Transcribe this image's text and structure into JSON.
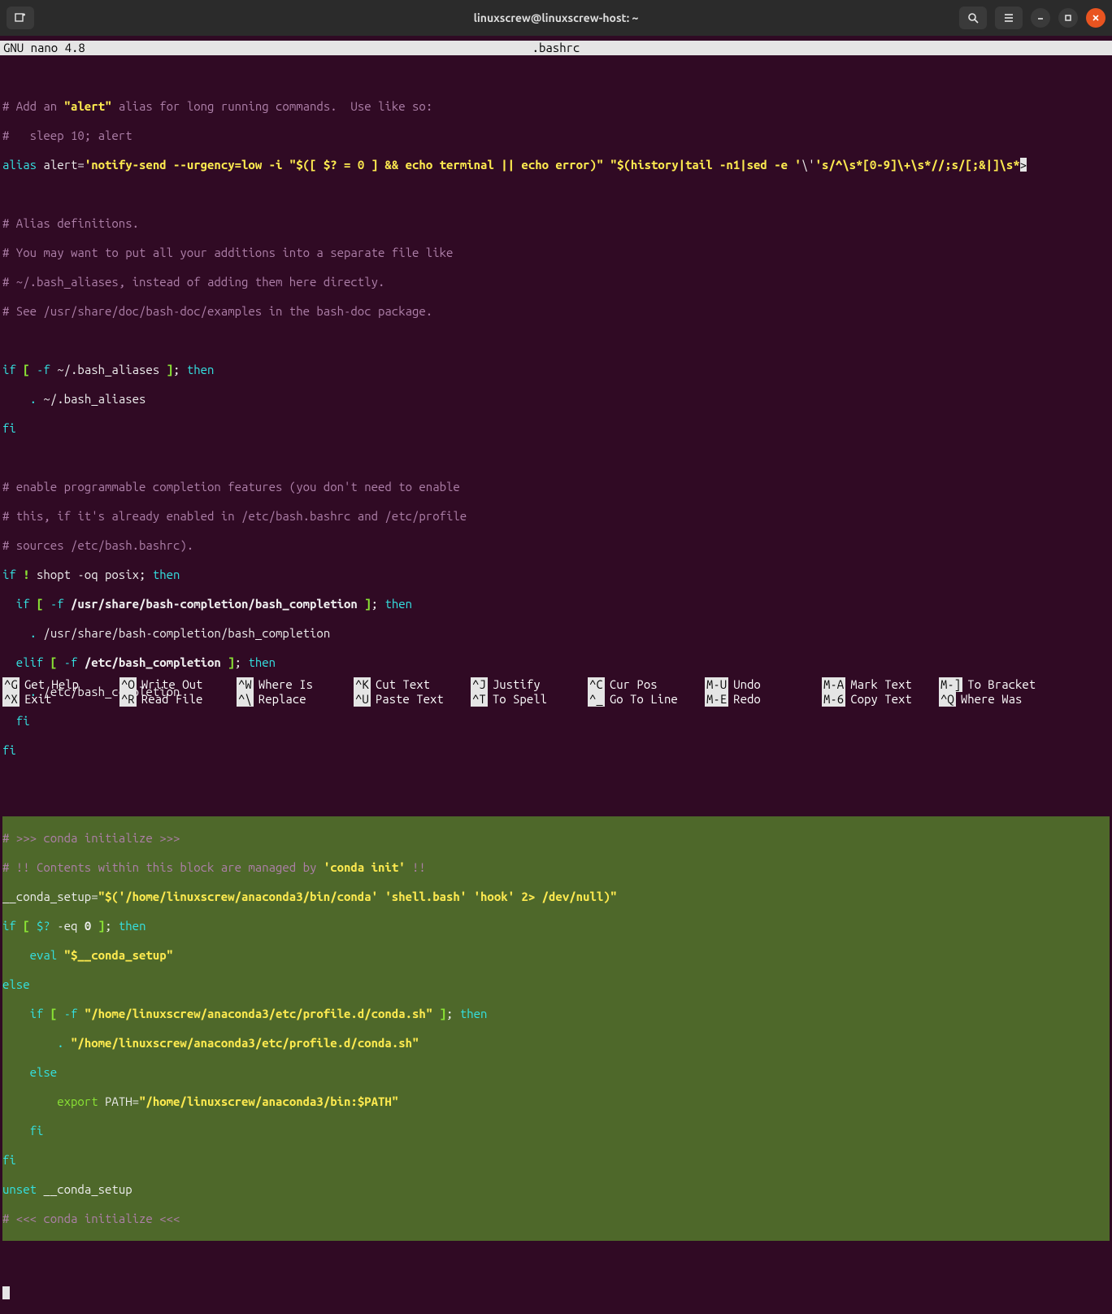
{
  "window": {
    "title": "linuxscrew@linuxscrew-host: ~"
  },
  "nano": {
    "app": "  GNU nano 4.8",
    "filename": ".bashrc"
  },
  "code": {
    "l1a": "# Add an ",
    "l1b": "\"alert\"",
    "l1c": " alias for long running commands.  Use like so:",
    "l2": "#   sleep 10; alert",
    "l3a": "alias",
    "l3b": " alert=",
    "l3c": "'notify-send --urgency=low -i \"$([ $? = 0 ] && echo terminal || echo error)\" \"$(history|tail -n1|sed -e '",
    "l3d": "\\'",
    "l3e": "'s/^\\s*[0-9]\\+\\s*//;s/[;&|]\\s*",
    "l3f": ">",
    "l5": "# Alias definitions.",
    "l6": "# You may want to put all your additions into a separate file like",
    "l7": "# ~/.bash_aliases, instead of adding them here directly.",
    "l8": "# See /usr/share/doc/bash-doc/examples in the bash-doc package.",
    "l10a": "if ",
    "l10b": "[ ",
    "l10c": "-f ",
    "l10d": "~/.bash_aliases",
    "l10e": " ]",
    "l10f": "; ",
    "l10g": "then",
    "l11a": "    ",
    "l11b": ". ",
    "l11c": "~/.bash_aliases",
    "l12": "fi",
    "l14": "# enable programmable completion features (you don't need to enable",
    "l15": "# this, if it's already enabled in /etc/bash.bashrc and /etc/profile",
    "l16": "# sources /etc/bash.bashrc).",
    "l17a": "if ",
    "l17b": "!",
    "l17c": " shopt -oq posix; ",
    "l17d": "then",
    "l18a": "  if ",
    "l18b": "[ ",
    "l18c": "-f ",
    "l18d": "/usr/share/bash-completion/bash_completion",
    "l18e": " ]",
    "l18f": "; ",
    "l18g": "then",
    "l19a": "    ",
    "l19b": ". ",
    "l19c": "/usr/share/bash-completion/bash_completion",
    "l20a": "  elif ",
    "l20b": "[ ",
    "l20c": "-f ",
    "l20d": "/etc/bash_completion",
    "l20e": " ]",
    "l20f": "; ",
    "l20g": "then",
    "l21a": "    ",
    "l21b": ". ",
    "l21c": "/etc/bash_completion",
    "l22": "  fi",
    "l23": "fi",
    "s1": "# >>> conda initialize >>>",
    "s2a": "# !! Contents within this block are managed by ",
    "s2b": "'conda init'",
    "s2c": " !!",
    "s3a": "__conda_setup=",
    "s3b": "\"$('/home/linuxscrew/anaconda3/bin/conda' 'shell.bash' 'hook' 2> /dev/null)\"",
    "s4a": "if ",
    "s4b": "[ ",
    "s4c": "$?",
    "s4d": " -eq ",
    "s4e": "0",
    "s4f": " ]",
    "s4g": "; ",
    "s4h": "then",
    "s5a": "    eval ",
    "s5b": "\"$__conda_setup\"",
    "s6": "else",
    "s7a": "    if ",
    "s7b": "[ ",
    "s7c": "-f ",
    "s7d": "\"/home/linuxscrew/anaconda3/etc/profile.d/conda.sh\"",
    "s7e": " ]",
    "s7f": "; ",
    "s7g": "then",
    "s8a": "        ",
    "s8b": ". ",
    "s8c": "\"/home/linuxscrew/anaconda3/etc/profile.d/conda.sh\"",
    "s9": "    else",
    "s10a": "        export ",
    "s10b": "PATH=",
    "s10c": "\"/home/linuxscrew/anaconda3/bin:$PATH\"",
    "s11": "    fi",
    "s12": "fi",
    "s13a": "unset",
    "s13b": " __conda_setup",
    "s14": "# <<< conda initialize <<<"
  },
  "help": {
    "r1": [
      {
        "k": "^G",
        "t": "Get Help"
      },
      {
        "k": "^O",
        "t": "Write Out"
      },
      {
        "k": "^W",
        "t": "Where Is"
      },
      {
        "k": "^K",
        "t": "Cut Text"
      },
      {
        "k": "^J",
        "t": "Justify"
      },
      {
        "k": "^C",
        "t": "Cur Pos"
      },
      {
        "k": "M-U",
        "t": "Undo"
      },
      {
        "k": "M-A",
        "t": "Mark Text"
      },
      {
        "k": "M-]",
        "t": "To Bracket"
      }
    ],
    "r2": [
      {
        "k": "^X",
        "t": "Exit"
      },
      {
        "k": "^R",
        "t": "Read File"
      },
      {
        "k": "^\\",
        "t": "Replace"
      },
      {
        "k": "^U",
        "t": "Paste Text"
      },
      {
        "k": "^T",
        "t": "To Spell"
      },
      {
        "k": "^_",
        "t": "Go To Line"
      },
      {
        "k": "M-E",
        "t": "Redo"
      },
      {
        "k": "M-6",
        "t": "Copy Text"
      },
      {
        "k": "^Q",
        "t": "Where Was"
      }
    ]
  }
}
